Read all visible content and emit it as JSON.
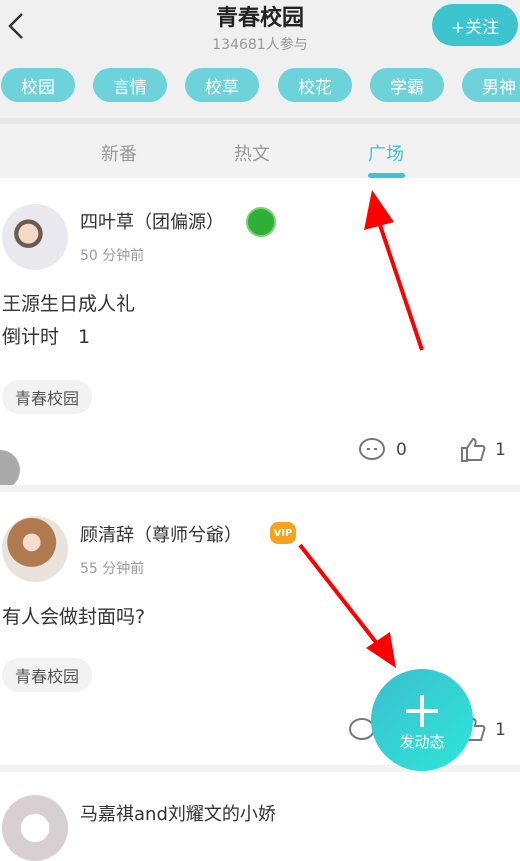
{
  "header": {
    "title": "青春校园",
    "participants": "134681人参与",
    "follow_label": "+关注",
    "back_icon": "chevron-left-icon"
  },
  "chips": [
    "校园",
    "言情",
    "校草",
    "校花",
    "学霸",
    "男神"
  ],
  "tabs": [
    {
      "label": "新番"
    },
    {
      "label": "热文"
    },
    {
      "label": "广场",
      "active": true
    }
  ],
  "posts": [
    {
      "name": "四叶草（团偏源）",
      "badge": "green-medal-badge",
      "time": "50 分钟前",
      "body": [
        "王源生日成人礼",
        "倒计时　1"
      ],
      "tag": "青春校园",
      "comments": "0",
      "likes": "1"
    },
    {
      "name": "顾清辞（尊师兮爺）",
      "badge": "VIP",
      "time": "55 分钟前",
      "body": [
        "有人会做封面吗?"
      ],
      "tag": "青春校园",
      "comments": "",
      "likes": "1"
    },
    {
      "name": "马嘉祺and刘耀文的小娇"
    }
  ],
  "fab": {
    "label": "发动态",
    "icon": "plus-icon"
  },
  "colors": {
    "accent": "#3cc4cf",
    "chip": "#6dd2d9",
    "annotation_arrow": "#ff0000"
  }
}
